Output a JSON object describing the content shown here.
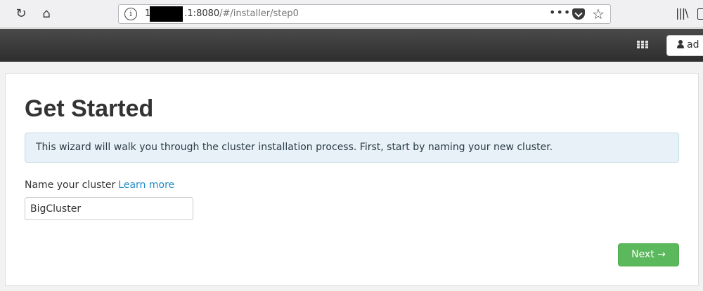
{
  "browser": {
    "url_prefix": "1",
    "url_suffix": ".1:8080",
    "url_path": "/#/installer/step0",
    "icons": [
      "reload-icon",
      "home-icon",
      "info-icon",
      "page-actions-icon",
      "pocket-icon",
      "bookmark-star-icon",
      "library-icon",
      "sidebar-icon"
    ]
  },
  "app_header": {
    "grid_icon": "apps-grid-icon",
    "user_label": "ad"
  },
  "wizard": {
    "title": "Get Started",
    "info_message": "This wizard will walk you through the cluster installation process. First, start by naming your new cluster.",
    "name_label": "Name your cluster",
    "learn_more": "Learn more",
    "cluster_name_value": "BigCluster",
    "next_label": "Next →"
  },
  "colors": {
    "header_bg": "#333333",
    "accent_link": "#1e8bc3",
    "next_button": "#5cb85c",
    "alert_bg": "#e8f1f7"
  }
}
